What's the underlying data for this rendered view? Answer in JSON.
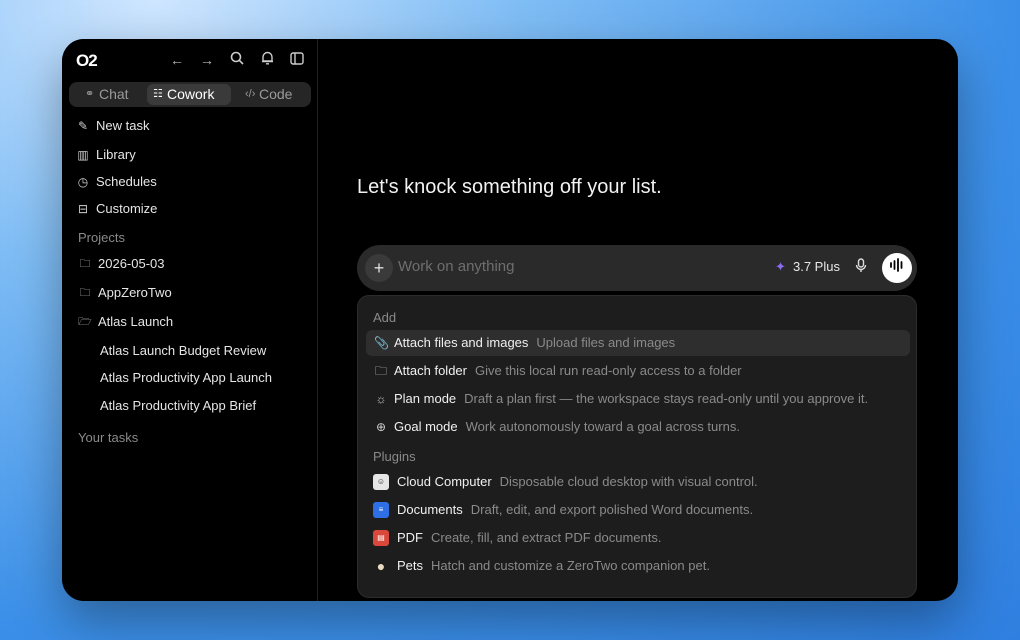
{
  "app": {
    "logo": "O2"
  },
  "topbar": {
    "icons": [
      "back-arrow-icon",
      "forward-arrow-icon",
      "search-icon",
      "bell-icon",
      "sidebar-toggle-icon"
    ]
  },
  "modes": [
    {
      "label": "Chat",
      "icon": "chat-icon"
    },
    {
      "label": "Cowork",
      "icon": "cowork-icon",
      "active": true
    },
    {
      "label": "Code",
      "icon": "code-icon"
    }
  ],
  "nav": [
    {
      "label": "New task",
      "icon": "edit-icon"
    },
    {
      "label": "Library",
      "icon": "library-icon"
    },
    {
      "label": "Schedules",
      "icon": "clock-icon"
    },
    {
      "label": "Customize",
      "icon": "briefcase-icon"
    }
  ],
  "projects": {
    "header": "Projects",
    "items": [
      {
        "label": "2026-05-03",
        "icon": "folder-icon"
      },
      {
        "label": "AppZeroTwo",
        "icon": "folder-icon"
      },
      {
        "label": "Atlas Launch",
        "icon": "folder-open-icon"
      }
    ],
    "tasks": [
      "Atlas Launch Budget Review",
      "Atlas Productivity App Launch",
      "Atlas Productivity App Brief"
    ]
  },
  "your_tasks": "Your tasks",
  "main": {
    "headline": "Let's knock something off your list.",
    "composer": {
      "placeholder": "Work on anything",
      "model": "3.7 Plus"
    }
  },
  "menu": {
    "add_header": "Add",
    "add_items": [
      {
        "label": "Attach files and images",
        "desc": "Upload files and images",
        "icon": "paperclip-icon"
      },
      {
        "label": "Attach folder",
        "desc": "Give this local run read-only access to a folder",
        "icon": "folder-icon"
      },
      {
        "label": "Plan mode",
        "desc": "Draft a plan first — the workspace stays read-only until you approve it.",
        "icon": "lightbulb-icon"
      },
      {
        "label": "Goal mode",
        "desc": "Work autonomously toward a goal across turns.",
        "icon": "target-icon"
      }
    ],
    "plugins_header": "Plugins",
    "plugins": [
      {
        "label": "Cloud Computer",
        "desc": "Disposable cloud desktop with visual control.",
        "icon": "cloud-computer-icon",
        "color": "#e6e6e6"
      },
      {
        "label": "Documents",
        "desc": "Draft, edit, and export polished Word documents.",
        "icon": "documents-icon",
        "color": "#2f6fe6"
      },
      {
        "label": "PDF",
        "desc": "Create, fill, and extract PDF documents.",
        "icon": "pdf-icon",
        "color": "#d9483b"
      },
      {
        "label": "Pets",
        "desc": "Hatch and customize a ZeroTwo companion pet.",
        "icon": "egg-icon",
        "color": "#e8dcc4"
      }
    ]
  }
}
